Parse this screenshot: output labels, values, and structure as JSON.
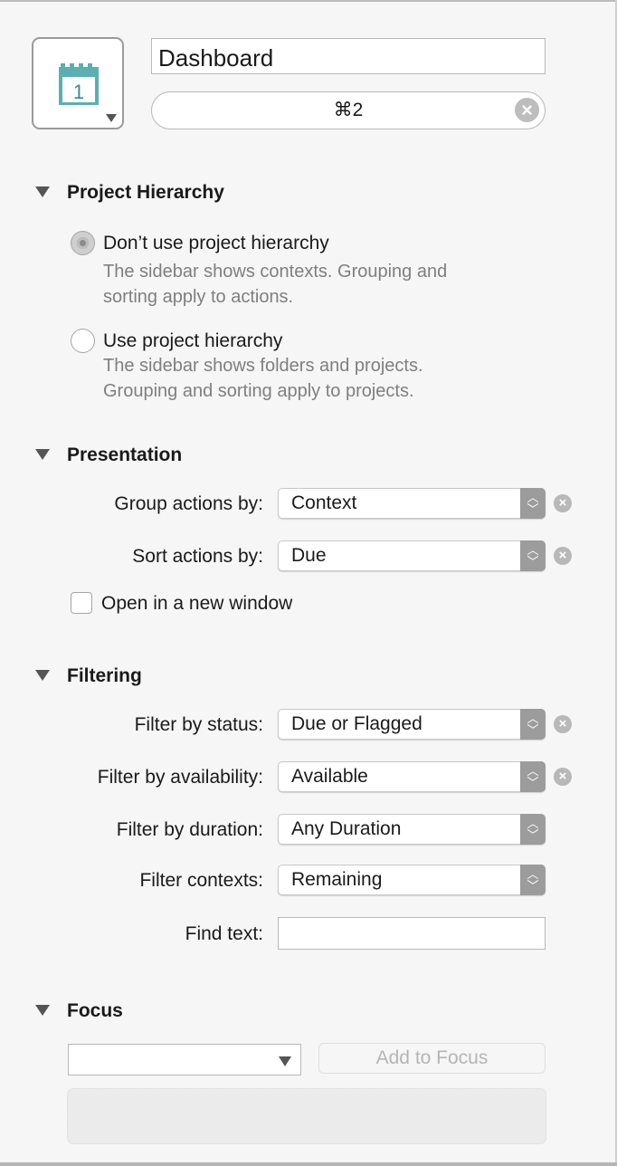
{
  "header": {
    "icon": "calendar-icon",
    "calendar_day": "1",
    "name_value": "Dashboard",
    "shortcut_value": "⌘2"
  },
  "project_hierarchy": {
    "title": "Project Hierarchy",
    "options": [
      {
        "label": "Don’t use project hierarchy",
        "description": [
          "The sidebar shows contexts. Grouping and",
          "sorting apply to actions."
        ],
        "selected": true
      },
      {
        "label": "Use project hierarchy",
        "description": [
          "The sidebar shows folders and projects.",
          "Grouping and sorting apply to projects."
        ],
        "selected": false
      }
    ]
  },
  "presentation": {
    "title": "Presentation",
    "group_label": "Group actions by:",
    "group_value": "Context",
    "sort_label": "Sort actions by:",
    "sort_value": "Due",
    "new_window_label": "Open in a new window",
    "new_window_checked": false
  },
  "filtering": {
    "title": "Filtering",
    "status_label": "Filter by status:",
    "status_value": "Due or Flagged",
    "availability_label": "Filter by availability:",
    "availability_value": "Available",
    "duration_label": "Filter by duration:",
    "duration_value": "Any Duration",
    "contexts_label": "Filter contexts:",
    "contexts_value": "Remaining",
    "find_label": "Find text:",
    "find_value": ""
  },
  "focus": {
    "title": "Focus",
    "select_value": "",
    "add_button": "Add to Focus"
  },
  "colors": {
    "calendar": "#5ab0b0",
    "background": "#f6f6f6"
  }
}
